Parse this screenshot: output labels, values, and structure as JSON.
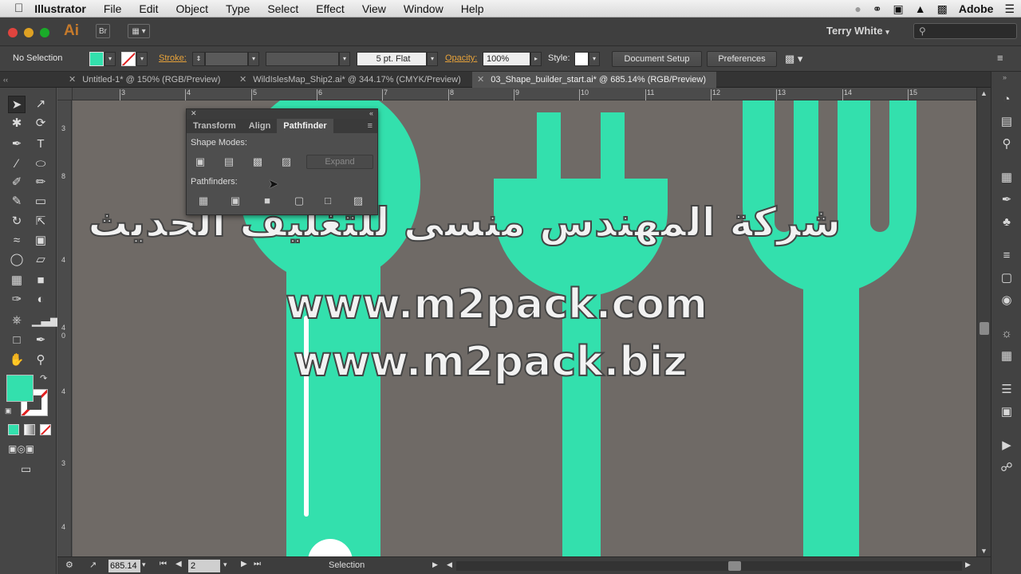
{
  "menubar": {
    "app_name": "Illustrator",
    "items": [
      "File",
      "Edit",
      "Object",
      "Type",
      "Select",
      "Effect",
      "View",
      "Window",
      "Help"
    ],
    "right_label": "Adobe"
  },
  "appbar": {
    "logo": "Ai",
    "bridge": "Br",
    "user": "Terry White"
  },
  "control": {
    "selection": "No Selection",
    "stroke_label": "Stroke:",
    "brush": "5 pt. Flat",
    "opacity_label": "Opacity:",
    "opacity_value": "100%",
    "style_label": "Style:",
    "document_setup": "Document Setup",
    "preferences": "Preferences"
  },
  "tabs": [
    {
      "label": "Untitled-1* @ 150% (RGB/Preview)"
    },
    {
      "label": "WildIslesMap_Ship2.ai* @ 344.17% (CMYK/Preview)"
    },
    {
      "label": "03_Shape_builder_start.ai* @ 685.14% (RGB/Preview)"
    }
  ],
  "ruler": {
    "h": [
      "3",
      "4",
      "5",
      "6",
      "7",
      "8",
      "9",
      "10",
      "11",
      "12",
      "13",
      "14",
      "15"
    ],
    "v": [
      "3",
      "8",
      "4",
      "0",
      "4",
      "4",
      "3",
      "4"
    ]
  },
  "pathfinder": {
    "tabs": [
      "Transform",
      "Align",
      "Pathfinder"
    ],
    "shape_modes": "Shape Modes:",
    "expand": "Expand",
    "pathfinders": "Pathfinders:"
  },
  "watermark": {
    "arabic": "شركة المهندس منسى للتغليف الحديث",
    "url1": "www.m2pack.com",
    "url2": "www.m2pack.biz"
  },
  "status": {
    "zoom": "685.14",
    "artboard": "2",
    "tool": "Selection"
  },
  "colors": {
    "accent": "#33e0ad",
    "canvas": "#6f6a66",
    "ui_dark": "#424242"
  }
}
